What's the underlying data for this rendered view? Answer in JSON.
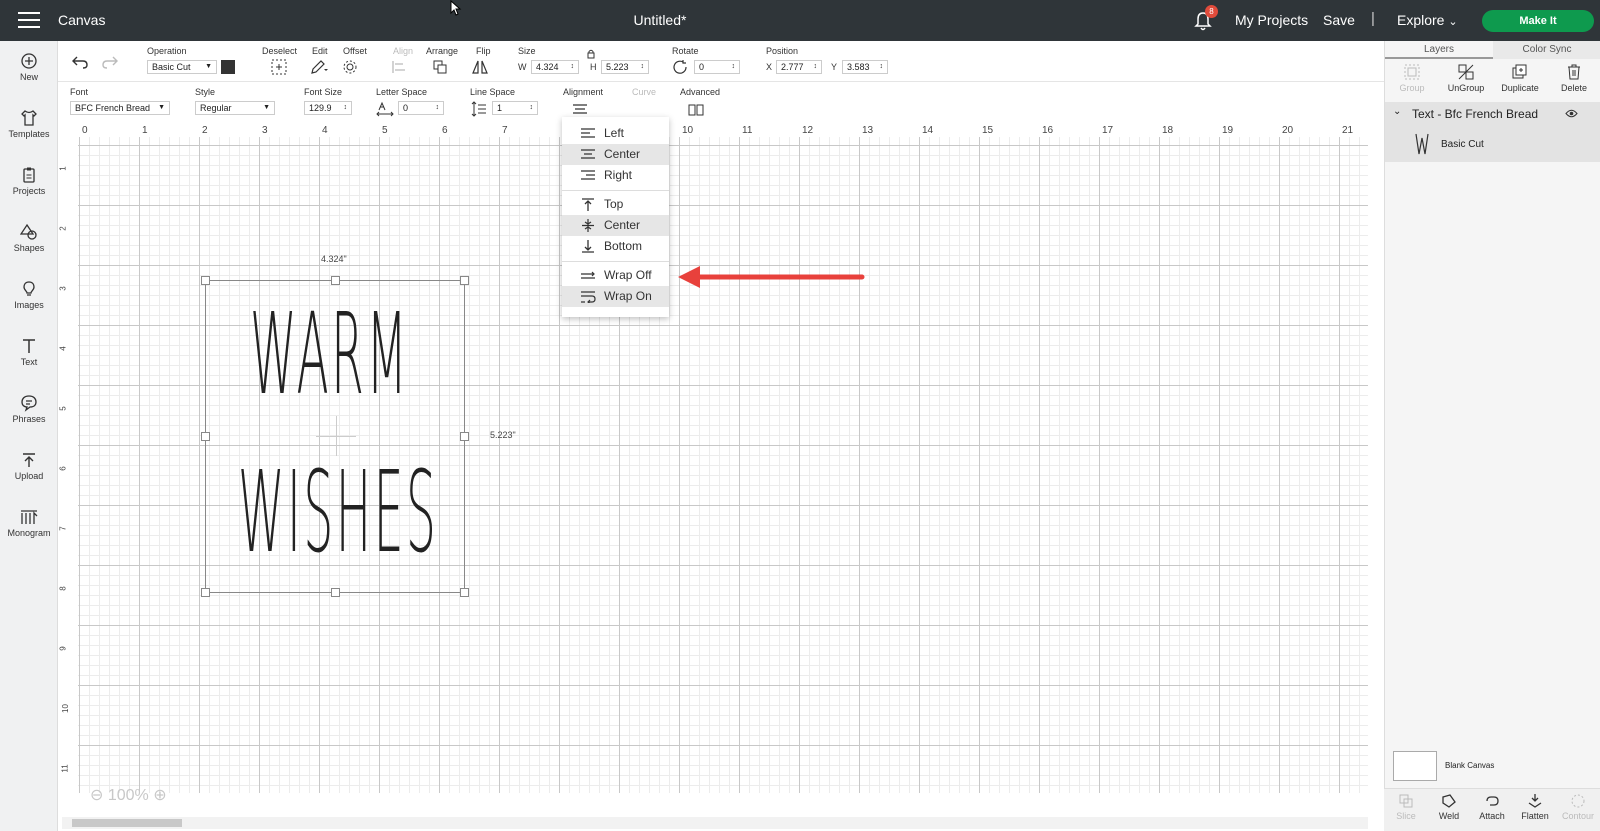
{
  "topbar": {
    "app_name": "Canvas",
    "doc_title": "Untitled*",
    "notification_count": "8",
    "my_projects": "My Projects",
    "save": "Save",
    "separator": "|",
    "explore": "Explore",
    "make_it": "Make It"
  },
  "leftbar": {
    "items": [
      {
        "label": "New",
        "icon": "plus-circle-icon"
      },
      {
        "label": "Templates",
        "icon": "shirt-icon"
      },
      {
        "label": "Projects",
        "icon": "clipboard-icon"
      },
      {
        "label": "Shapes",
        "icon": "shapes-icon"
      },
      {
        "label": "Images",
        "icon": "lightbulb-icon"
      },
      {
        "label": "Text",
        "icon": "text-icon"
      },
      {
        "label": "Phrases",
        "icon": "speech-bubble-icon"
      },
      {
        "label": "Upload",
        "icon": "upload-icon"
      },
      {
        "label": "Monogram",
        "icon": "monogram-icon"
      }
    ]
  },
  "toolbar1": {
    "operation_label": "Operation",
    "operation_value": "Basic Cut",
    "deselect": "Deselect",
    "edit": "Edit",
    "offset": "Offset",
    "align": "Align",
    "arrange": "Arrange",
    "flip": "Flip",
    "size": "Size",
    "w_label": "W",
    "w_value": "4.324",
    "h_label": "H",
    "h_value": "5.223",
    "rotate": "Rotate",
    "rotate_value": "0",
    "position": "Position",
    "x_label": "X",
    "x_value": "2.777",
    "y_label": "Y",
    "y_value": "3.583"
  },
  "toolbar2": {
    "font_label": "Font",
    "font_value": "BFC French Bread",
    "style_label": "Style",
    "style_value": "Regular",
    "font_size_label": "Font Size",
    "font_size_value": "129.9",
    "letter_space_label": "Letter Space",
    "letter_space_value": "0",
    "line_space_label": "Line Space",
    "line_space_value": "1",
    "alignment_label": "Alignment",
    "curve_label": "Curve",
    "advanced_label": "Advanced"
  },
  "ruler": {
    "h_ticks": [
      "0",
      "1",
      "2",
      "3",
      "4",
      "5",
      "6",
      "7",
      "8",
      "9",
      "10",
      "11",
      "12",
      "13",
      "14",
      "15",
      "16",
      "17",
      "18",
      "19",
      "20",
      "21"
    ],
    "v_ticks": [
      "1",
      "2",
      "3",
      "4",
      "5",
      "6",
      "7",
      "8",
      "9",
      "10",
      "11"
    ]
  },
  "artwork": {
    "width_dim": "4.324\"",
    "height_dim": "5.223\"",
    "line1": "WARM",
    "line2": "WISHES"
  },
  "alignment_menu": {
    "items": [
      {
        "label": "Left",
        "highlighted": false
      },
      {
        "label": "Center",
        "highlighted": true
      },
      {
        "label": "Right",
        "highlighted": false
      },
      {
        "label": "Top",
        "highlighted": false
      },
      {
        "label": "Center",
        "highlighted": true
      },
      {
        "label": "Bottom",
        "highlighted": false
      },
      {
        "label": "Wrap Off",
        "highlighted": false
      },
      {
        "label": "Wrap On",
        "highlighted": true
      }
    ]
  },
  "zoom_level": "100%",
  "right_panel": {
    "tabs": [
      "Layers",
      "Color Sync"
    ],
    "actions": [
      "Group",
      "UnGroup",
      "Duplicate",
      "Delete"
    ],
    "layer_title": "Text - Bfc French Bread",
    "layer_sub": "Basic Cut",
    "blank_canvas": "Blank Canvas",
    "bottom_actions": [
      "Slice",
      "Weld",
      "Attach",
      "Flatten",
      "Contour"
    ]
  },
  "colors": {
    "topbar": "#2f3539",
    "make_it": "#0e9a4e",
    "badge": "#e14b3b",
    "arrow": "#e8413c"
  }
}
